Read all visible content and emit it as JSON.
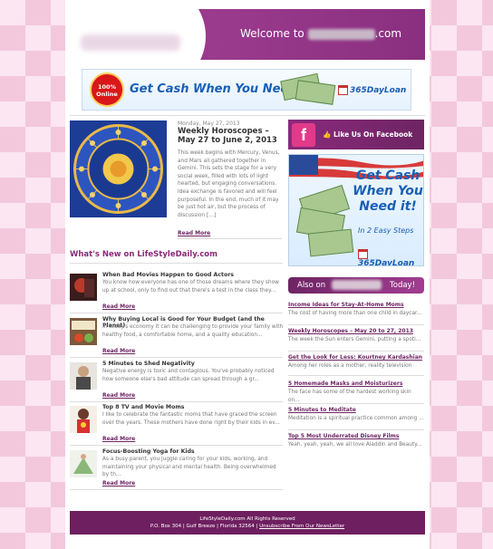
{
  "header": {
    "welcome_prefix": "Welcome to",
    "welcome_suffix": ".com"
  },
  "top_banner": {
    "badge": "100% Online",
    "headline": "Get Cash When You Need it!",
    "brand": "365DayLoan"
  },
  "featured_post": {
    "date": "Monday, May 27, 2013",
    "title": "Weekly Horoscopes – May 27 to June 2, 2013",
    "excerpt": "This week begins with Mercury, Venus, and Mars all gathered together in Gemini. This sets the stage for a very social week, filled with lots of light hearted, but engaging conversations. Idea exchange is favored and will feel purposeful. In the end, much of it may be just hot air, but the process of discussion […]",
    "read_more": "Read More"
  },
  "whats_new": {
    "heading": "What's New on LifeStyleDaily.com",
    "articles": [
      {
        "title": "When Bad Movies Happen to Good Actors",
        "text": "You know how everyone has one of those dreams where they show up at school, only to find out that there's a test in the class they...",
        "read_more": "Read More"
      },
      {
        "title": "Why Buying Local is Good for Your Budget (and the Planet)",
        "text": "In today's economy it can be challenging to provide your family with healthy food, a comfortable home, and a quality education...",
        "read_more": "Read More"
      },
      {
        "title": "5 Minutes to Shed Negativity",
        "text": "Negative energy is toxic and contagious. You've probably noticed how someone else's bad attitude can spread through a gr...",
        "read_more": "Read More"
      },
      {
        "title": "Top 8 TV and Movie Moms",
        "text": "I like to celebrate the fantastic moms that have graced the screen over the years. These mothers have done right by their kids in ev...",
        "read_more": "Read More"
      },
      {
        "title": "Focus-Boosting Yoga for Kids",
        "text": "As a busy parent, you juggle caring for your kids, working, and maintaining your physical and mental health. Being overwhelmed by th...",
        "read_more": "Read More"
      }
    ]
  },
  "facebook": {
    "icon_letter": "f",
    "label": "Like Us On Facebook"
  },
  "side_ad": {
    "headline": "Get Cash When You Need it!",
    "steps": "In 2 Easy Steps",
    "brand": "365DayLoan"
  },
  "also_on": {
    "prefix": "Also on",
    "suffix": "Today!",
    "items": [
      {
        "title": "Income Ideas for Stay-At-Home Moms",
        "text": "The cost of having more than one child in daycar..."
      },
      {
        "title": "Weekly Horoscopes – May 20 to 27, 2013",
        "text": "The week the Sun enters Gemini, putting a spoti..."
      },
      {
        "title": "Get the Look for Less: Kourtney Kardashian",
        "text": "Among her roles as a mother, reality television"
      },
      {
        "title": "5 Homemade Masks and Moisturizers",
        "text": "The face has some of the hardest working skin on..."
      },
      {
        "title": "5 Minutes to Meditate",
        "text": "Meditation is a spiritual practice common among ..."
      },
      {
        "title": "Top 5 Most Underrated Disney Films",
        "text": "Yeah, yeah, yeah, we all love Aladdin and Beauty..."
      }
    ]
  },
  "footer": {
    "line1": "LifeStyleDaily.com All Rights Reserved",
    "address": "P.O. Box 304 | Gulf Breeze | Florida 32564 |",
    "unsubscribe": "Unsubscribe From Our NewsLetter"
  },
  "colors": {
    "brand_purple": "#6e2463",
    "accent_magenta": "#8a2a7a",
    "ad_blue": "#1a5fb4"
  }
}
